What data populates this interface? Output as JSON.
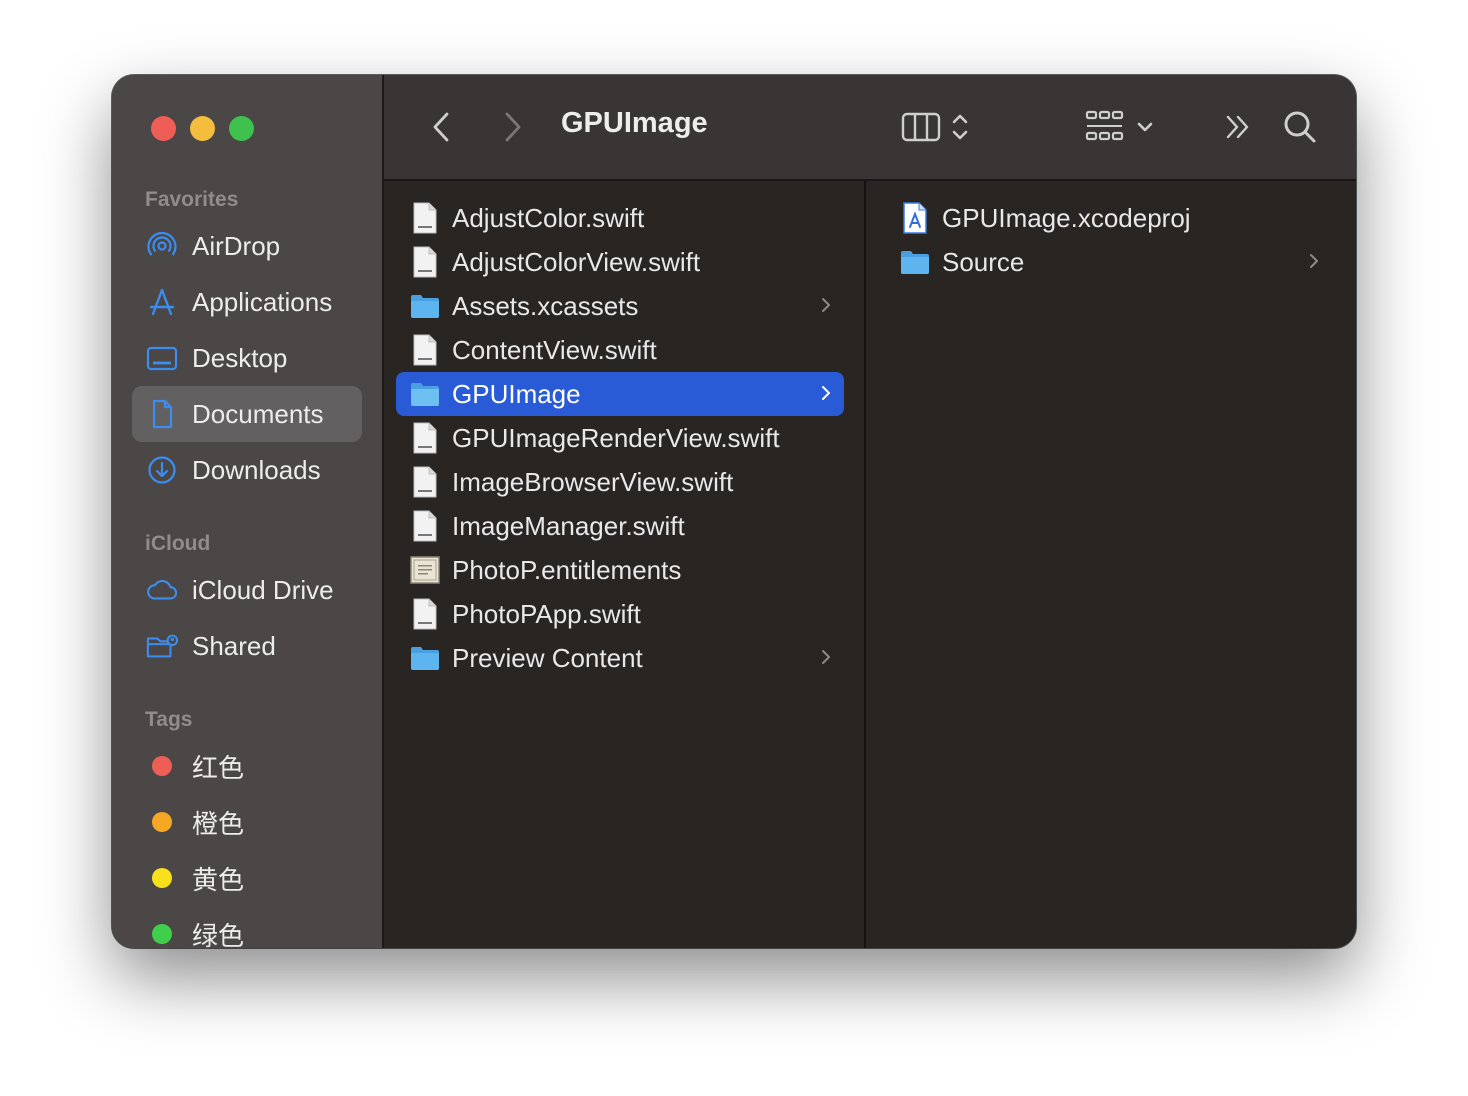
{
  "window": {
    "title": "GPUImage"
  },
  "colors": {
    "close": "#ee5e57",
    "minimize": "#f5bd3e",
    "maximize": "#3fc14d",
    "accent": "#2a5bd7",
    "sidebar_icon": "#3b8df0",
    "folder": "#5eb4ee"
  },
  "sidebar": {
    "favorites_title": "Favorites",
    "favorites": [
      {
        "label": "AirDrop",
        "icon": "airdrop-icon"
      },
      {
        "label": "Applications",
        "icon": "applications-icon"
      },
      {
        "label": "Desktop",
        "icon": "desktop-icon"
      },
      {
        "label": "Documents",
        "icon": "document-icon",
        "selected": true
      },
      {
        "label": "Downloads",
        "icon": "downloads-icon"
      }
    ],
    "icloud_title": "iCloud",
    "icloud": [
      {
        "label": "iCloud Drive",
        "icon": "cloud-icon"
      },
      {
        "label": "Shared",
        "icon": "shared-folder-icon"
      }
    ],
    "tags_title": "Tags",
    "tags": [
      {
        "label": "红色",
        "color": "#ee5e57"
      },
      {
        "label": "橙色",
        "color": "#f5a623"
      },
      {
        "label": "黄色",
        "color": "#f8e01c"
      },
      {
        "label": "绿色",
        "color": "#3fcf4b"
      }
    ]
  },
  "column1": {
    "items": [
      {
        "name": "AdjustColor.swift",
        "kind": "swift-file-icon"
      },
      {
        "name": "AdjustColorView.swift",
        "kind": "swift-file-icon"
      },
      {
        "name": "Assets.xcassets",
        "kind": "folder-icon",
        "has_children": true
      },
      {
        "name": "ContentView.swift",
        "kind": "swift-file-icon"
      },
      {
        "name": "GPUImage",
        "kind": "folder-icon",
        "has_children": true,
        "selected": true
      },
      {
        "name": "GPUImageRenderView.swift",
        "kind": "swift-file-icon"
      },
      {
        "name": "ImageBrowserView.swift",
        "kind": "swift-file-icon"
      },
      {
        "name": "ImageManager.swift",
        "kind": "swift-file-icon"
      },
      {
        "name": "PhotoP.entitlements",
        "kind": "entitlements-icon"
      },
      {
        "name": "PhotoPApp.swift",
        "kind": "swift-file-icon"
      },
      {
        "name": "Preview Content",
        "kind": "folder-icon",
        "has_children": true
      }
    ]
  },
  "column2": {
    "items": [
      {
        "name": "GPUImage.xcodeproj",
        "kind": "xcodeproj-icon"
      },
      {
        "name": "Source",
        "kind": "folder-icon",
        "has_children": true
      }
    ]
  }
}
